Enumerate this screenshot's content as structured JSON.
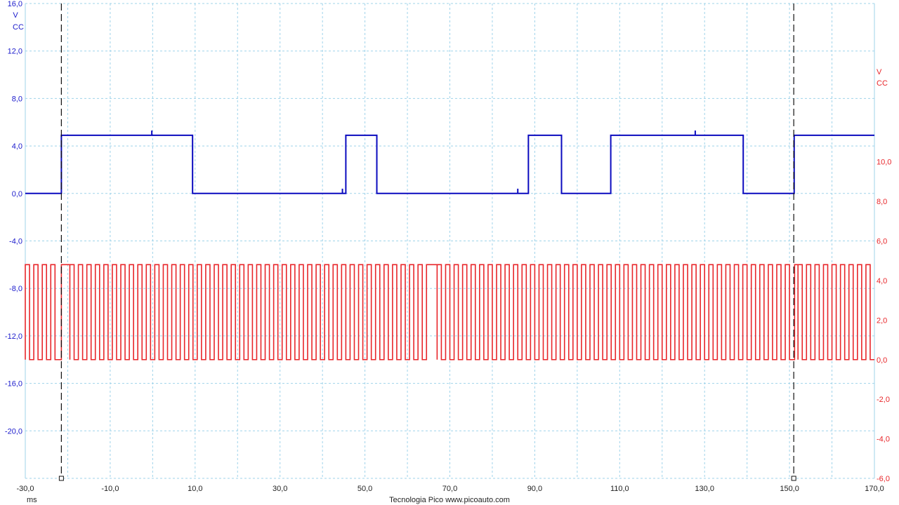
{
  "chart_data": {
    "type": "line",
    "title": "",
    "footer": "Tecnologia Pico  www.picoauto.com",
    "x": {
      "unit": "ms",
      "range": [
        -30,
        170
      ],
      "ticks": [
        -30,
        -10,
        10,
        30,
        50,
        70,
        90,
        110,
        130,
        150,
        170
      ],
      "tick_labels": [
        "-30,0",
        "-10,0",
        "10,0",
        "30,0",
        "50,0",
        "70,0",
        "90,0",
        "110,0",
        "130,0",
        "150,0",
        "170,0"
      ]
    },
    "axes": {
      "left": {
        "unit": "V",
        "coupling": "CC",
        "color": "#1a1acc",
        "range": [
          -24,
          16
        ],
        "ticks": [
          16,
          12,
          8,
          4,
          0,
          -4,
          -8,
          -12,
          -16,
          -20
        ],
        "tick_labels": [
          "16,0",
          "12,0",
          "8,0",
          "4,0",
          "0,0",
          "-4,0",
          "-8,0",
          "-12,0",
          "-16,0",
          "-20,0"
        ]
      },
      "right": {
        "unit": "V",
        "coupling": "CC",
        "color": "#e8262a",
        "range": [
          -6,
          18
        ],
        "ticks": [
          10,
          8,
          6,
          4,
          2,
          0,
          -2,
          -4,
          -6
        ],
        "tick_labels": [
          "10,0",
          "8,0",
          "6,0",
          "4,0",
          "2,0",
          "0,0",
          "-2,0",
          "-4,0",
          "-6,0"
        ]
      }
    },
    "grid": true,
    "series": [
      {
        "axis": "left",
        "color": "#0b0bbf",
        "type": "square",
        "low": 0.0,
        "high": 4.9,
        "transitions_ms": [
          -21.5,
          9.4,
          45.5,
          52.8,
          88.5,
          96.3,
          107.9,
          139.1,
          151.1
        ],
        "initial_level": "low",
        "end_ms": 170,
        "spikes": [
          {
            "x": -0.2,
            "y": 5.3
          },
          {
            "x": 44.7,
            "y": 0.4
          },
          {
            "x": 86.0,
            "y": 0.4
          },
          {
            "x": 127.8,
            "y": 5.3
          }
        ]
      },
      {
        "axis": "right",
        "color": "#e8262a",
        "type": "pulse-train",
        "low": 0.0,
        "high": 4.8,
        "period_ms": 2.0,
        "start_ms": -30,
        "end_ms": 170,
        "segments": [
          {
            "from": -30.0,
            "to": -22.0
          },
          {
            "from": -19.5,
            "to": 63.5
          },
          {
            "from": 67.0,
            "to": 150.5
          },
          {
            "from": 152.0,
            "to": 170.0
          }
        ],
        "gap_levels": [
          {
            "from": -22.0,
            "to": -21.5,
            "level": 0.0
          },
          {
            "from": -21.5,
            "to": -19.5,
            "level": 4.8
          },
          {
            "from": 63.5,
            "to": 64.5,
            "level": 0.0
          },
          {
            "from": 64.5,
            "to": 67.0,
            "level": 4.8
          },
          {
            "from": 150.5,
            "to": 151.2,
            "level": 0.0
          },
          {
            "from": 151.2,
            "to": 152.0,
            "level": 4.8
          }
        ]
      }
    ],
    "rulers_ms": [
      -21.5,
      151.0
    ]
  }
}
